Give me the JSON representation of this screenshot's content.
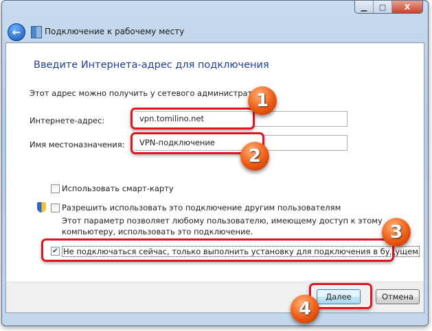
{
  "window": {
    "title": "Подключение к рабочему месту",
    "minimize": "▁",
    "maximize": "□",
    "close": "X"
  },
  "heading": "Введите Интернета-адрес для подключения",
  "hint": "Этот адрес можно получить у сетевого администратора.",
  "address": {
    "label": "Интернете-адрес:",
    "value": "vpn.tomilino.net"
  },
  "destination": {
    "label": "Имя местоназначения:",
    "value": "VPN-подключение"
  },
  "smartcard": {
    "label": "Использовать смарт-карту",
    "checked": false
  },
  "allow_others": {
    "label": "Разрешить использовать это подключение другим пользователям",
    "checked": false,
    "description_line1": "Этот параметр позволяет любому пользователю, имеющему доступ к этому",
    "description_line2": "компьютеру, использовать это подключение."
  },
  "dont_connect": {
    "label": "Не подключаться сейчас, только выполнить установку для подключения в будущем",
    "checked": true,
    "check": "✔"
  },
  "buttons": {
    "next": "Далее",
    "cancel": "Отмена"
  },
  "badges": [
    "1",
    "2",
    "3",
    "4"
  ]
}
